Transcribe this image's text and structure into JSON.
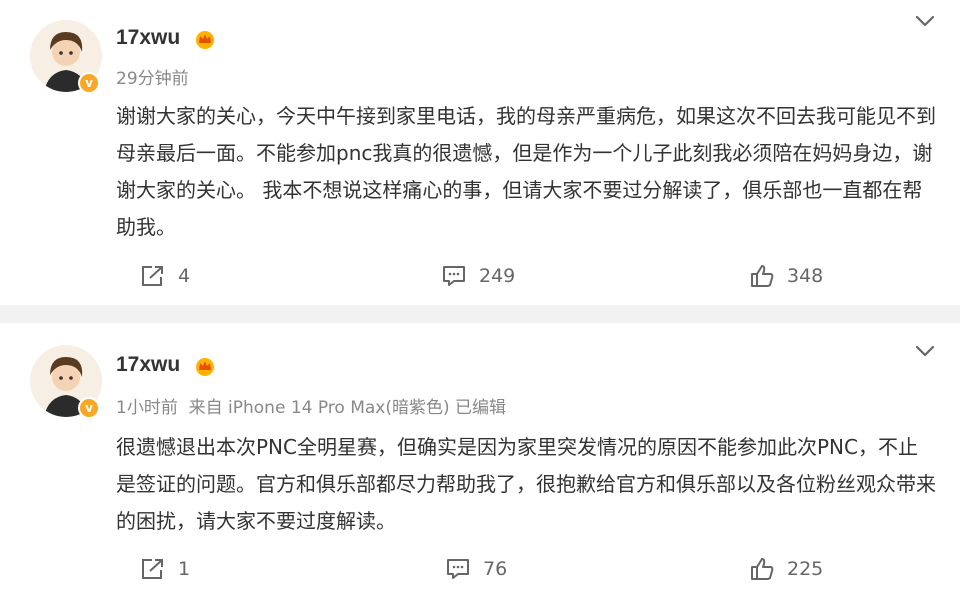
{
  "posts": [
    {
      "username": "17xwu",
      "meta": "29分钟前",
      "text": "谢谢大家的关心，今天中午接到家里电话，我的母亲严重病危，如果这次不回去我可能见不到母亲最后一面。不能参加pnc我真的很遗憾，但是作为一个儿子此刻我必须陪在妈妈身边，谢谢大家的关心。 我本不想说这样痛心的事，但请大家不要过分解读了，俱乐部也一直都在帮助我。",
      "reposts": "4",
      "comments": "249",
      "likes": "348"
    },
    {
      "username": "17xwu",
      "meta": "1小时前  来自 iPhone 14 Pro Max(暗紫色) 已编辑",
      "text": "很遗憾退出本次PNC全明星赛，但确实是因为家里突发情况的原因不能参加此次PNC，不止是签证的问题。官方和俱乐部都尽力帮助我了，很抱歉给官方和俱乐部以及各位粉丝观众带来的困扰，请大家不要过度解读。",
      "reposts": "1",
      "comments": "76",
      "likes": "225"
    }
  ],
  "colors": {
    "badge": "#f9a825",
    "separator": "#f2f2f2"
  },
  "icons": [
    "avatar",
    "verified-badge-icon",
    "crown-icon",
    "chevron-down-icon",
    "repost-icon",
    "comment-icon",
    "like-icon"
  ]
}
